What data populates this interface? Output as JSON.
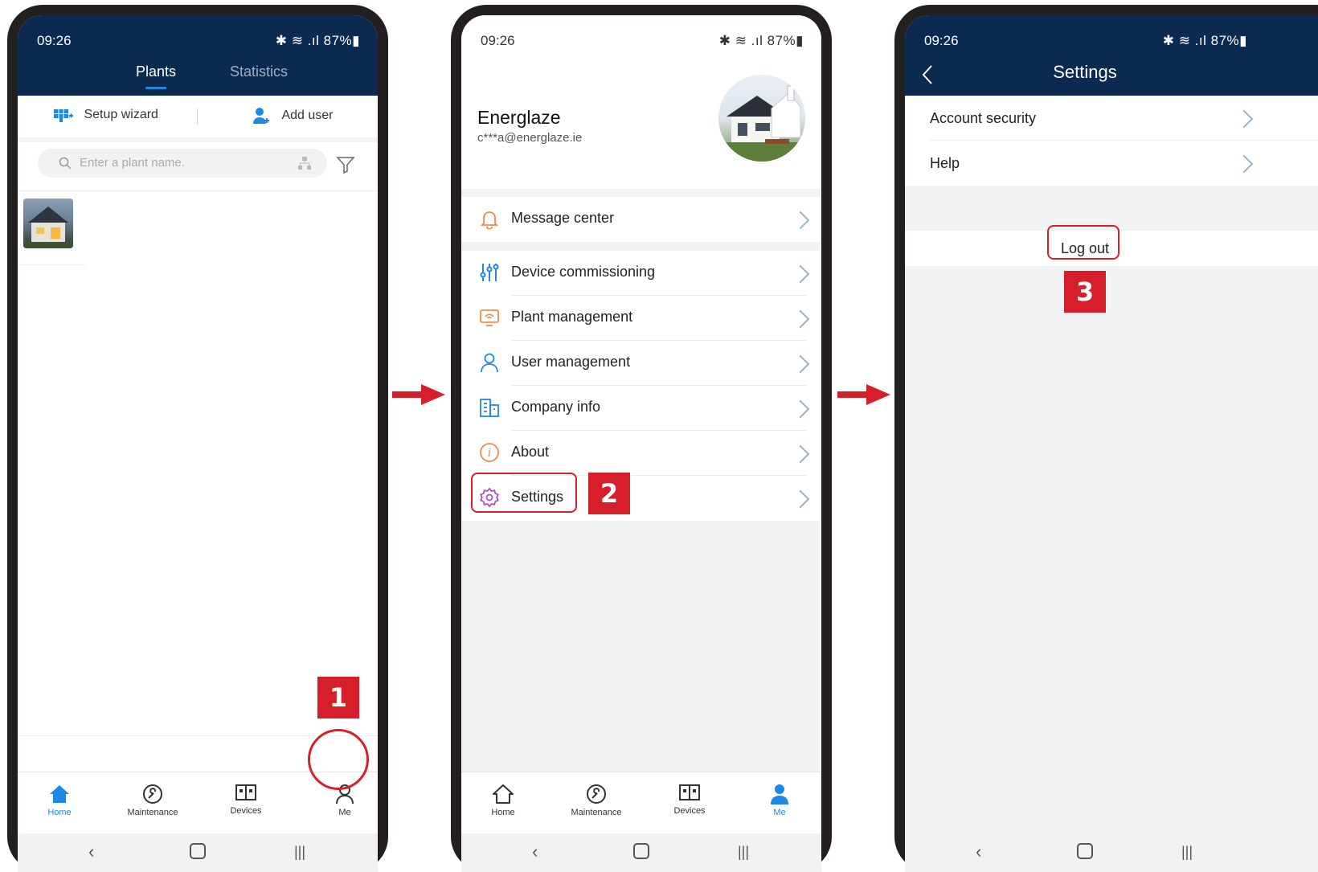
{
  "status": {
    "time": "09:26",
    "icons": "✱ ≋ .ıl 87%▮"
  },
  "screen1": {
    "tabs": [
      {
        "label": "Plants"
      },
      {
        "label": "Statistics"
      }
    ],
    "actions": {
      "setup_wizard": "Setup wizard",
      "add_user": "Add user"
    },
    "search": {
      "placeholder": "Enter a plant name."
    },
    "step_badge": "1"
  },
  "screen2": {
    "profile": {
      "name": "Energlaze",
      "email": "c***a@energlaze.ie"
    },
    "menu": {
      "message_center": "Message center",
      "device_commissioning": "Device commissioning",
      "plant_management": "Plant management",
      "user_management": "User management",
      "company_info": "Company info",
      "about": "About",
      "settings": "Settings"
    },
    "step_badge": "2"
  },
  "screen3": {
    "title": "Settings",
    "items": {
      "account_security": "Account security",
      "help": "Help"
    },
    "logout": "Log out",
    "step_badge": "3"
  },
  "nav": {
    "home": "Home",
    "maintenance": "Maintenance",
    "devices": "Devices",
    "me": "Me"
  },
  "colors": {
    "header": "#0b2a4f",
    "accent": "#1e88e5",
    "badge": "#d71f2c"
  },
  "icons": {
    "back": "chevron-left-icon",
    "home": "home-icon",
    "recent": "recent-apps-icon"
  }
}
